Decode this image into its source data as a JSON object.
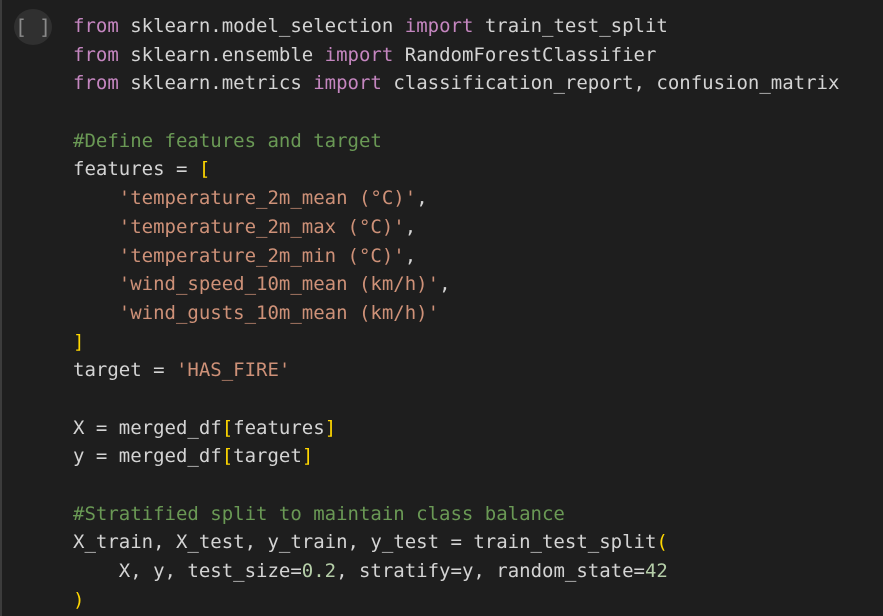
{
  "cell": {
    "run_label": "[ ]",
    "run_icon": "play-icon"
  },
  "code": {
    "lines": [
      [
        {
          "t": "from",
          "c": "kw"
        },
        {
          "t": " sklearn.model_selection ",
          "c": ""
        },
        {
          "t": "import",
          "c": "kw"
        },
        {
          "t": " train_test_split",
          "c": ""
        }
      ],
      [
        {
          "t": "from",
          "c": "kw"
        },
        {
          "t": " sklearn.ensemble ",
          "c": ""
        },
        {
          "t": "import",
          "c": "kw"
        },
        {
          "t": " RandomForestClassifier",
          "c": ""
        }
      ],
      [
        {
          "t": "from",
          "c": "kw"
        },
        {
          "t": " sklearn.metrics ",
          "c": ""
        },
        {
          "t": "import",
          "c": "kw"
        },
        {
          "t": " classification_report, confusion_matrix",
          "c": ""
        }
      ],
      [],
      [
        {
          "t": "#Define features and target",
          "c": "com"
        }
      ],
      [
        {
          "t": "features = ",
          "c": ""
        },
        {
          "t": "[",
          "c": "br"
        }
      ],
      [
        {
          "t": "    ",
          "c": ""
        },
        {
          "t": "'temperature_2m_mean (°C)'",
          "c": "str"
        },
        {
          "t": ",",
          "c": ""
        }
      ],
      [
        {
          "t": "    ",
          "c": ""
        },
        {
          "t": "'temperature_2m_max (°C)'",
          "c": "str"
        },
        {
          "t": ",",
          "c": ""
        }
      ],
      [
        {
          "t": "    ",
          "c": ""
        },
        {
          "t": "'temperature_2m_min (°C)'",
          "c": "str"
        },
        {
          "t": ",",
          "c": ""
        }
      ],
      [
        {
          "t": "    ",
          "c": ""
        },
        {
          "t": "'wind_speed_10m_mean (km/h)'",
          "c": "str"
        },
        {
          "t": ",",
          "c": ""
        }
      ],
      [
        {
          "t": "    ",
          "c": ""
        },
        {
          "t": "'wind_gusts_10m_mean (km/h)'",
          "c": "str"
        }
      ],
      [
        {
          "t": "]",
          "c": "br"
        }
      ],
      [
        {
          "t": "target = ",
          "c": ""
        },
        {
          "t": "'HAS_FIRE'",
          "c": "str"
        }
      ],
      [],
      [
        {
          "t": "X = merged_df",
          "c": ""
        },
        {
          "t": "[",
          "c": "br"
        },
        {
          "t": "features",
          "c": ""
        },
        {
          "t": "]",
          "c": "br"
        }
      ],
      [
        {
          "t": "y = merged_df",
          "c": ""
        },
        {
          "t": "[",
          "c": "br"
        },
        {
          "t": "target",
          "c": ""
        },
        {
          "t": "]",
          "c": "br"
        }
      ],
      [],
      [
        {
          "t": "#Stratified split to maintain class balance",
          "c": "com"
        }
      ],
      [
        {
          "t": "X_train, X_test, y_train, y_test = train_test_split",
          "c": ""
        },
        {
          "t": "(",
          "c": "br"
        }
      ],
      [
        {
          "t": "    X, y, test_size=",
          "c": ""
        },
        {
          "t": "0.2",
          "c": "num"
        },
        {
          "t": ", stratify=y, random_state=",
          "c": ""
        },
        {
          "t": "42",
          "c": "num"
        }
      ],
      [
        {
          "t": ")",
          "c": "br"
        }
      ]
    ]
  },
  "colors": {
    "background": "#1e1e1e",
    "keyword": "#c586c0",
    "string": "#ce9178",
    "comment": "#6a9955",
    "number": "#b5cea8",
    "bracket": "#ffd700"
  }
}
